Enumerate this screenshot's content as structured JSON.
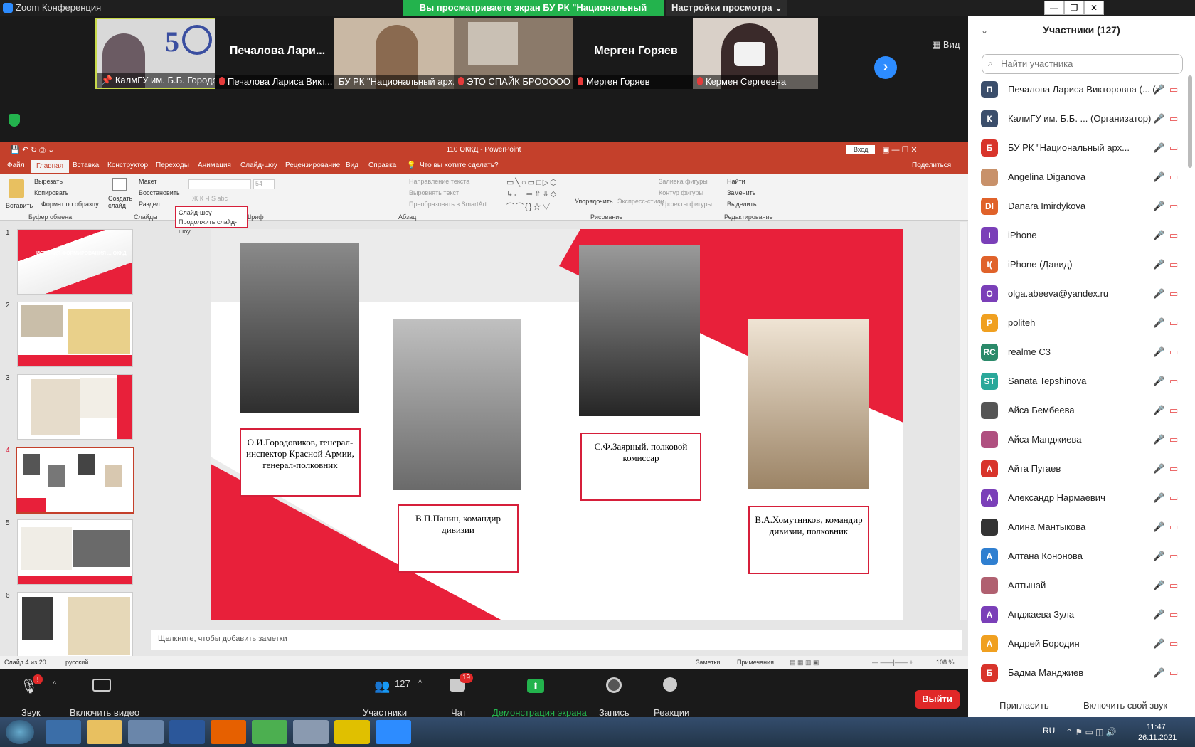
{
  "zoom": {
    "window_title": "Zoom Конференция",
    "share_banner": "Вы просматриваете экран БУ РК \"Национальный архив\"",
    "view_settings": "Настройки просмотра",
    "view_button": "Вид",
    "tiles": [
      {
        "name": "КалмГУ им. Б.Б. Городо..."
      },
      {
        "name": "Печалова Лариса Викт...",
        "big": "Печалова  Лари..."
      },
      {
        "name": "БУ РК \"Национальный арх..."
      },
      {
        "name": "ЭТО СПАЙК БРООООО"
      },
      {
        "name": "Мерген Горяев",
        "big": "Мерген Горяев"
      },
      {
        "name": "Кермен Сергеевна"
      }
    ],
    "toolbar": {
      "audio": "Звук",
      "video": "Включить видео",
      "participants": "Участники",
      "participants_count": "127",
      "chat": "Чат",
      "chat_badge": "19",
      "share": "Демонстрация экрана",
      "record": "Запись",
      "reactions": "Реакции",
      "end": "Выйти"
    }
  },
  "panel": {
    "title": "Участники (127)",
    "search_placeholder": "Найти участника",
    "invite": "Пригласить",
    "unmute": "Включить свой звук",
    "participants": [
      {
        "initial": "П",
        "color": "#3b4e6b",
        "name": "Печалова Лариса Викторовна (... (Я)"
      },
      {
        "initial": "К",
        "color": "#3b4e6b",
        "name": "КалмГУ им. Б.Б. ... (Организатор)"
      },
      {
        "initial": "Б",
        "color": "#d8342b",
        "name": "БУ РК \"Национальный арх..."
      },
      {
        "initial": "",
        "color": "#c8916a",
        "name": "Angelina Diganova"
      },
      {
        "initial": "DI",
        "color": "#e0622a",
        "name": "Danara Imirdykova"
      },
      {
        "initial": "I",
        "color": "#7a3fb8",
        "name": "iPhone"
      },
      {
        "initial": "I(",
        "color": "#e0622a",
        "name": "iPhone (Давид)"
      },
      {
        "initial": "O",
        "color": "#7a3fb8",
        "name": "olga.abeeva@yandex.ru"
      },
      {
        "initial": "P",
        "color": "#f0a020",
        "name": "politeh"
      },
      {
        "initial": "RC",
        "color": "#2b8a6a",
        "name": "realme C3"
      },
      {
        "initial": "ST",
        "color": "#2aa89a",
        "name": "Sanata Tepshinova"
      },
      {
        "initial": "",
        "color": "#555555",
        "name": "Айса Бембеева"
      },
      {
        "initial": "",
        "color": "#b05080",
        "name": "Айса Манджиева"
      },
      {
        "initial": "А",
        "color": "#d8342b",
        "name": "Айта Пугаев"
      },
      {
        "initial": "А",
        "color": "#7a3fb8",
        "name": "Александр Нармаевич"
      },
      {
        "initial": "",
        "color": "#333333",
        "name": "Алина Мантыкова"
      },
      {
        "initial": "А",
        "color": "#2f7fd0",
        "name": "Алтана Кононова"
      },
      {
        "initial": "",
        "color": "#b06070",
        "name": "Алтынай"
      },
      {
        "initial": "А",
        "color": "#7a3fb8",
        "name": "Анджаева Зула"
      },
      {
        "initial": "А",
        "color": "#f0a020",
        "name": "Андрей Бородин"
      },
      {
        "initial": "Б",
        "color": "#d8342b",
        "name": "Бадма Манджиев"
      }
    ]
  },
  "ppt": {
    "title": "110 ОККД  -  PowerPoint",
    "signin": "Вход",
    "share": "Поделиться",
    "tabs": [
      "Файл",
      "Главная",
      "Вставка",
      "Конструктор",
      "Переходы",
      "Анимация",
      "Слайд-шоу",
      "Рецензирование",
      "Вид",
      "Справка",
      "Что вы хотите сделать?"
    ],
    "ribbon": {
      "paste": "Вставить",
      "cut": "Вырезать",
      "copy": "Копировать",
      "format": "Формат по образцу",
      "clipboard": "Буфер обмена",
      "new_slide": "Создать слайд",
      "layout": "Макет",
      "reset": "Восстановить",
      "section": "Раздел",
      "slides": "Слайды",
      "font": "Шрифт",
      "paragraph": "Абзац",
      "text_dir": "Направление текста",
      "align_text": "Выровнять текст",
      "smartart": "Преобразовать в SmartArt",
      "arrange": "Упорядочить",
      "quick_styles": "Экспресс-стили",
      "fill": "Заливка фигуры",
      "outline": "Контур фигуры",
      "effects": "Эффекты фигуры",
      "drawing": "Рисование",
      "find": "Найти",
      "replace": "Заменить",
      "select": "Выделить",
      "editing": "Редактирование",
      "font_size": "54"
    },
    "popup": {
      "title": "Слайд-шоу",
      "item": "Продолжить слайд-шоу"
    },
    "slide_numbers": [
      "1",
      "2",
      "3",
      "4",
      "5",
      "6"
    ],
    "thumb1_text": "ИСТОРИЯ ФОРМИРОВАНИЯ ... ОККД",
    "captions": [
      "О.И.Городовиков, генерал-инспектор Красной Армии, генерал-полковник",
      "В.П.Панин, командир дивизии",
      "С.Ф.Заярный, полковой комиссар",
      "В.А.Хомутников, командир дивизии, полковник"
    ],
    "notes_placeholder": "Щелкните, чтобы добавить заметки",
    "status_slide": "Слайд 4 из 20",
    "status_lang": "русский",
    "status_notes": "Заметки",
    "status_comments": "Примечания",
    "zoom_level": "108 %"
  },
  "taskbar": {
    "lang": "RU",
    "time": "11:47",
    "date": "26.11.2021"
  },
  "colors": {
    "zoom_blue": "#2d8cff",
    "share_green": "#23b34d",
    "ppt_red": "#c4402b",
    "slide_red": "#e8203a",
    "end_red": "#e02828"
  }
}
